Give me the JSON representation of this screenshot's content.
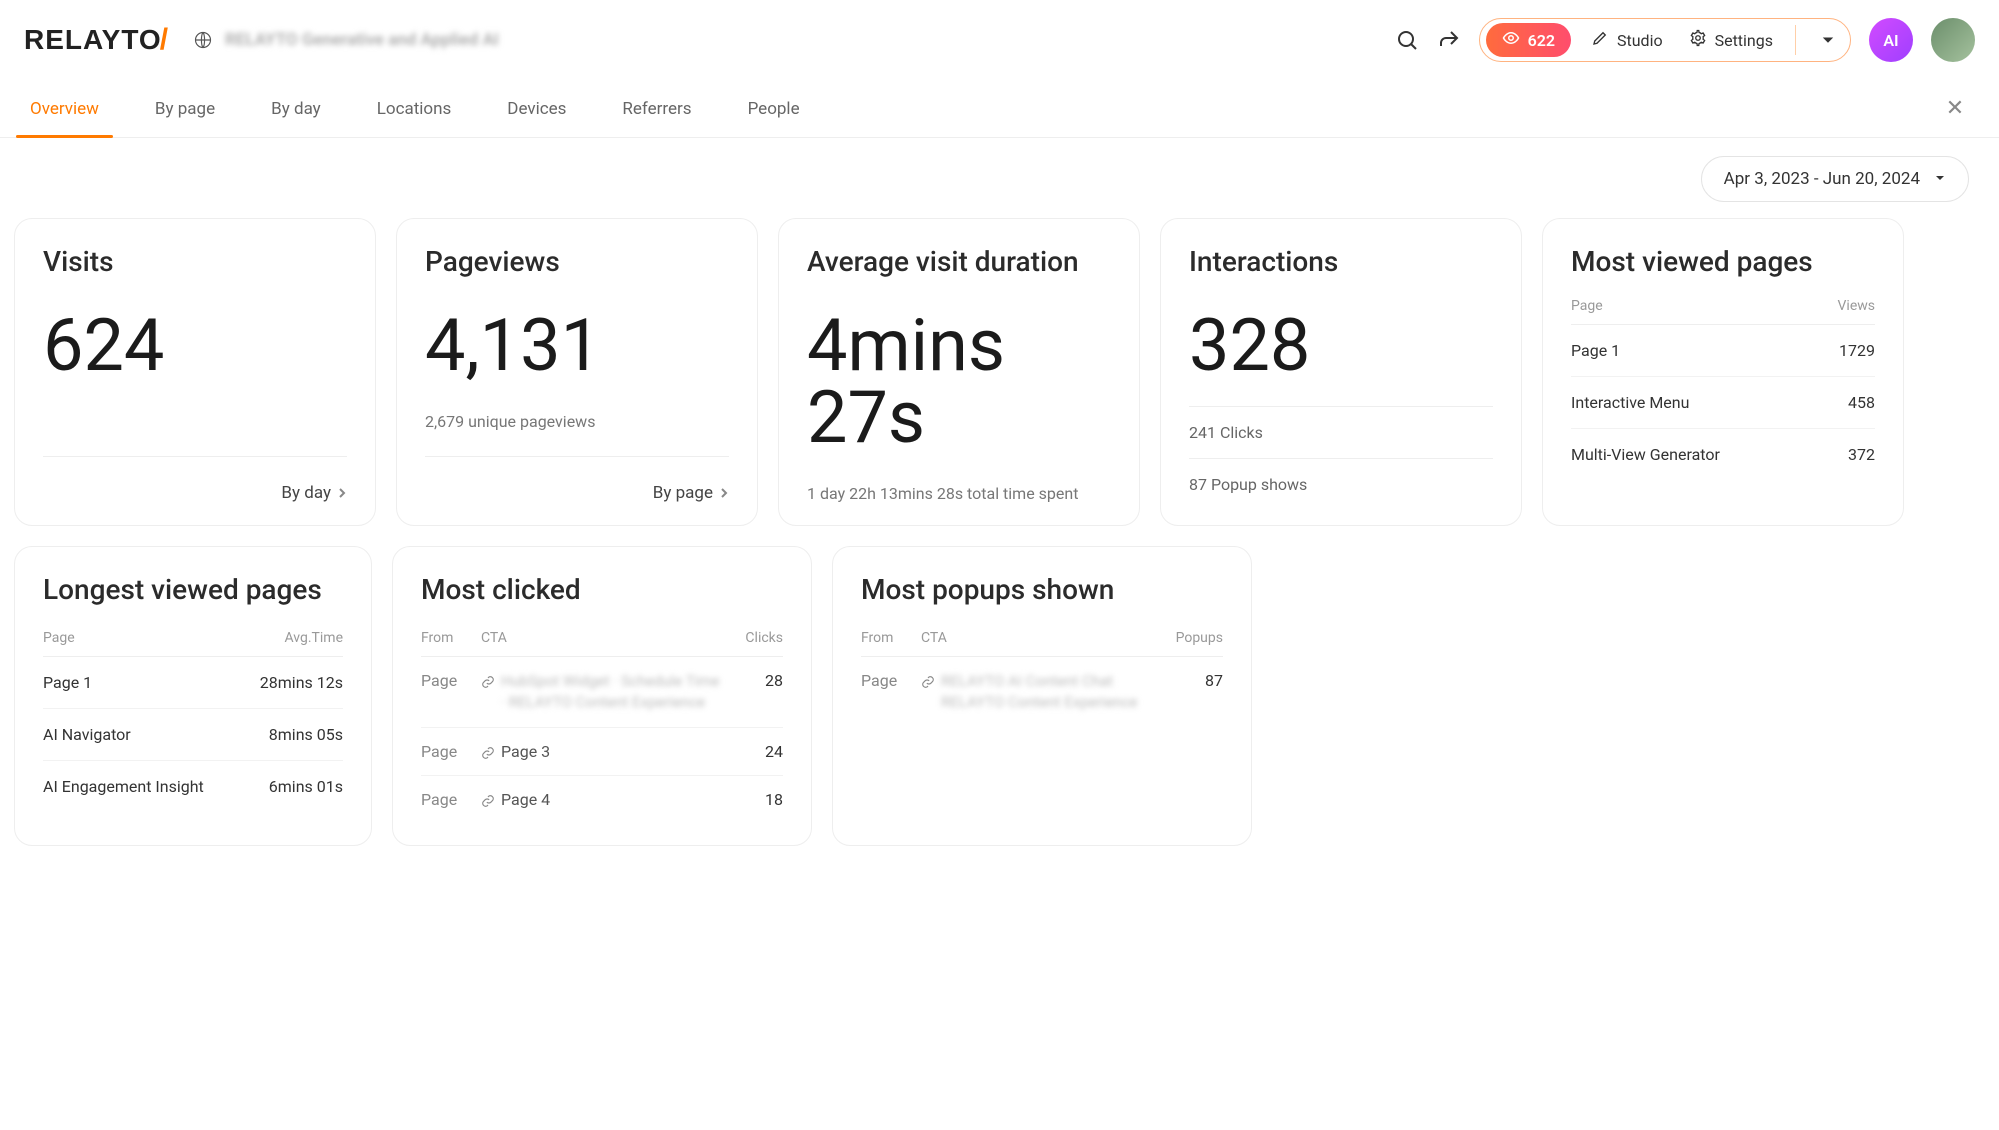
{
  "header": {
    "logo_text": "RELAYTO",
    "logo_slash": "/",
    "doc_title_blur": "RELAYTO Generative and Applied AI",
    "views_count": "622",
    "studio_label": "Studio",
    "settings_label": "Settings",
    "avatar_ai": "AI"
  },
  "tabs": {
    "items": [
      "Overview",
      "By page",
      "By day",
      "Locations",
      "Devices",
      "Referrers",
      "People"
    ],
    "active_index": 0
  },
  "date_range": "Apr 3, 2023 - Jun 20, 2024",
  "cards": {
    "visits": {
      "title": "Visits",
      "value": "624",
      "footer_link": "By day"
    },
    "pageviews": {
      "title": "Pageviews",
      "value": "4,131",
      "subtext": "2,679 unique pageviews",
      "footer_link": "By page"
    },
    "avg_duration": {
      "title": "Average visit duration",
      "value": "4mins 27s",
      "subtext": "1 day 22h 13mins 28s total time spent"
    },
    "interactions": {
      "title": "Interactions",
      "value": "328",
      "rows": [
        "241 Clicks",
        "87 Popup shows"
      ]
    },
    "most_viewed": {
      "title": "Most viewed pages",
      "head": {
        "c1": "Page",
        "c2": "Views"
      },
      "rows": [
        {
          "page": "Page 1",
          "views": "1729"
        },
        {
          "page": "Interactive Menu",
          "views": "458"
        },
        {
          "page": "Multi-View Generator",
          "views": "372"
        }
      ]
    }
  },
  "row2": {
    "longest": {
      "title": "Longest viewed pages",
      "head": {
        "c1": "Page",
        "c2": "Avg.Time"
      },
      "rows": [
        {
          "page": "Page 1",
          "time": "28mins 12s"
        },
        {
          "page": "AI Navigator",
          "time": "8mins 05s"
        },
        {
          "page": "AI Engagement Insight",
          "time": "6mins 01s"
        }
      ]
    },
    "most_clicked": {
      "title": "Most clicked",
      "head": {
        "c1": "From",
        "c2": "CTA",
        "c3": "Clicks"
      },
      "rows": [
        {
          "from": "Page",
          "cta_blur": "HubSpot Widget · Schedule Time · RELAYTO Content Experience",
          "clicks": "28"
        },
        {
          "from": "Page",
          "cta": "Page 3",
          "clicks": "24"
        },
        {
          "from": "Page",
          "cta": "Page 4",
          "clicks": "18"
        }
      ]
    },
    "most_popups": {
      "title": "Most popups shown",
      "head": {
        "c1": "From",
        "c2": "CTA",
        "c3": "Popups"
      },
      "rows": [
        {
          "from": "Page",
          "cta_blur": "RELAYTO AI Content Chat RELAYTO Content Experience",
          "popups": "87"
        }
      ]
    }
  }
}
